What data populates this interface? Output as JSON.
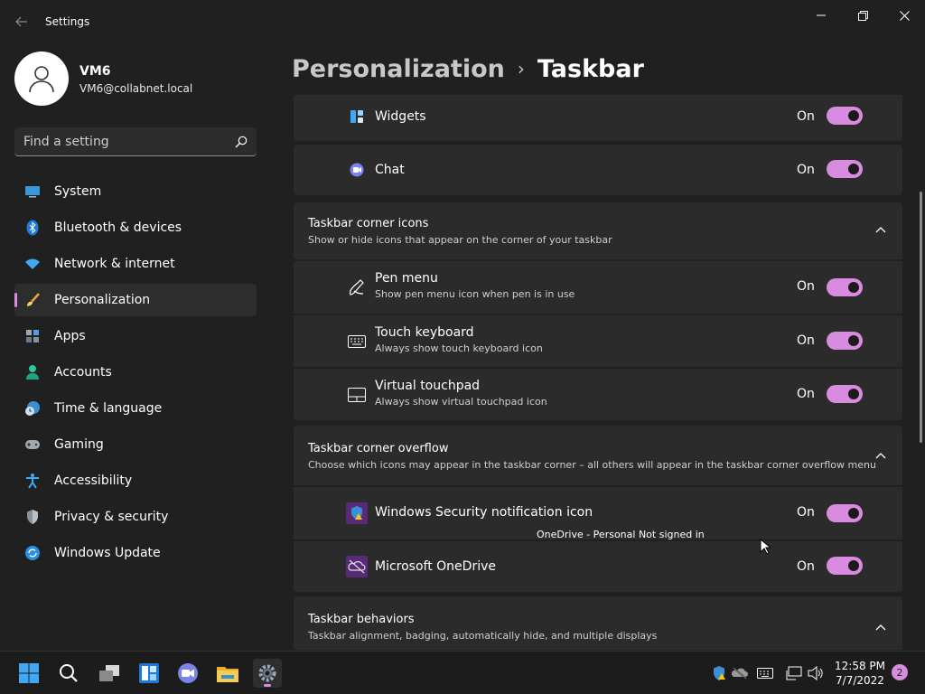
{
  "window": {
    "title": "Settings"
  },
  "user": {
    "name": "VM6",
    "email": "VM6@collabnet.local"
  },
  "search": {
    "placeholder": "Find a setting"
  },
  "sidebar": {
    "items": [
      {
        "label": "System",
        "icon": "monitor-icon"
      },
      {
        "label": "Bluetooth & devices",
        "icon": "bluetooth-icon"
      },
      {
        "label": "Network & internet",
        "icon": "wifi-icon"
      },
      {
        "label": "Personalization",
        "icon": "brush-icon",
        "active": true
      },
      {
        "label": "Apps",
        "icon": "apps-icon"
      },
      {
        "label": "Accounts",
        "icon": "person-icon"
      },
      {
        "label": "Time & language",
        "icon": "clock-globe-icon"
      },
      {
        "label": "Gaming",
        "icon": "gamepad-icon"
      },
      {
        "label": "Accessibility",
        "icon": "accessibility-icon"
      },
      {
        "label": "Privacy & security",
        "icon": "shield-icon"
      },
      {
        "label": "Windows Update",
        "icon": "update-icon"
      }
    ]
  },
  "breadcrumb": {
    "parent": "Personalization",
    "separator": "›",
    "current": "Taskbar"
  },
  "taskbar_items": {
    "widgets": {
      "title": "Widgets",
      "state": "On"
    },
    "chat": {
      "title": "Chat",
      "state": "On"
    }
  },
  "corner_icons": {
    "title": "Taskbar corner icons",
    "desc": "Show or hide icons that appear on the corner of your taskbar",
    "items": [
      {
        "title": "Pen menu",
        "desc": "Show pen menu icon when pen is in use",
        "state": "On"
      },
      {
        "title": "Touch keyboard",
        "desc": "Always show touch keyboard icon",
        "state": "On"
      },
      {
        "title": "Virtual touchpad",
        "desc": "Always show virtual touchpad icon",
        "state": "On"
      }
    ]
  },
  "corner_overflow": {
    "title": "Taskbar corner overflow",
    "desc": "Choose which icons may appear in the taskbar corner – all others will appear in the taskbar corner overflow menu",
    "items": [
      {
        "title": "Windows Security notification icon",
        "state": "On"
      },
      {
        "title": "Microsoft OneDrive",
        "state": "On"
      }
    ]
  },
  "tooltip": "OneDrive - Personal Not signed in",
  "behaviors": {
    "title": "Taskbar behaviors",
    "desc": "Taskbar alignment, badging, automatically hide, and multiple displays"
  },
  "clock": {
    "time": "12:58 PM",
    "date": "7/7/2022"
  },
  "notifications": {
    "count": "2"
  },
  "colors": {
    "accent": "#d98be0",
    "background": "#202020",
    "card": "#2b2b2b"
  }
}
